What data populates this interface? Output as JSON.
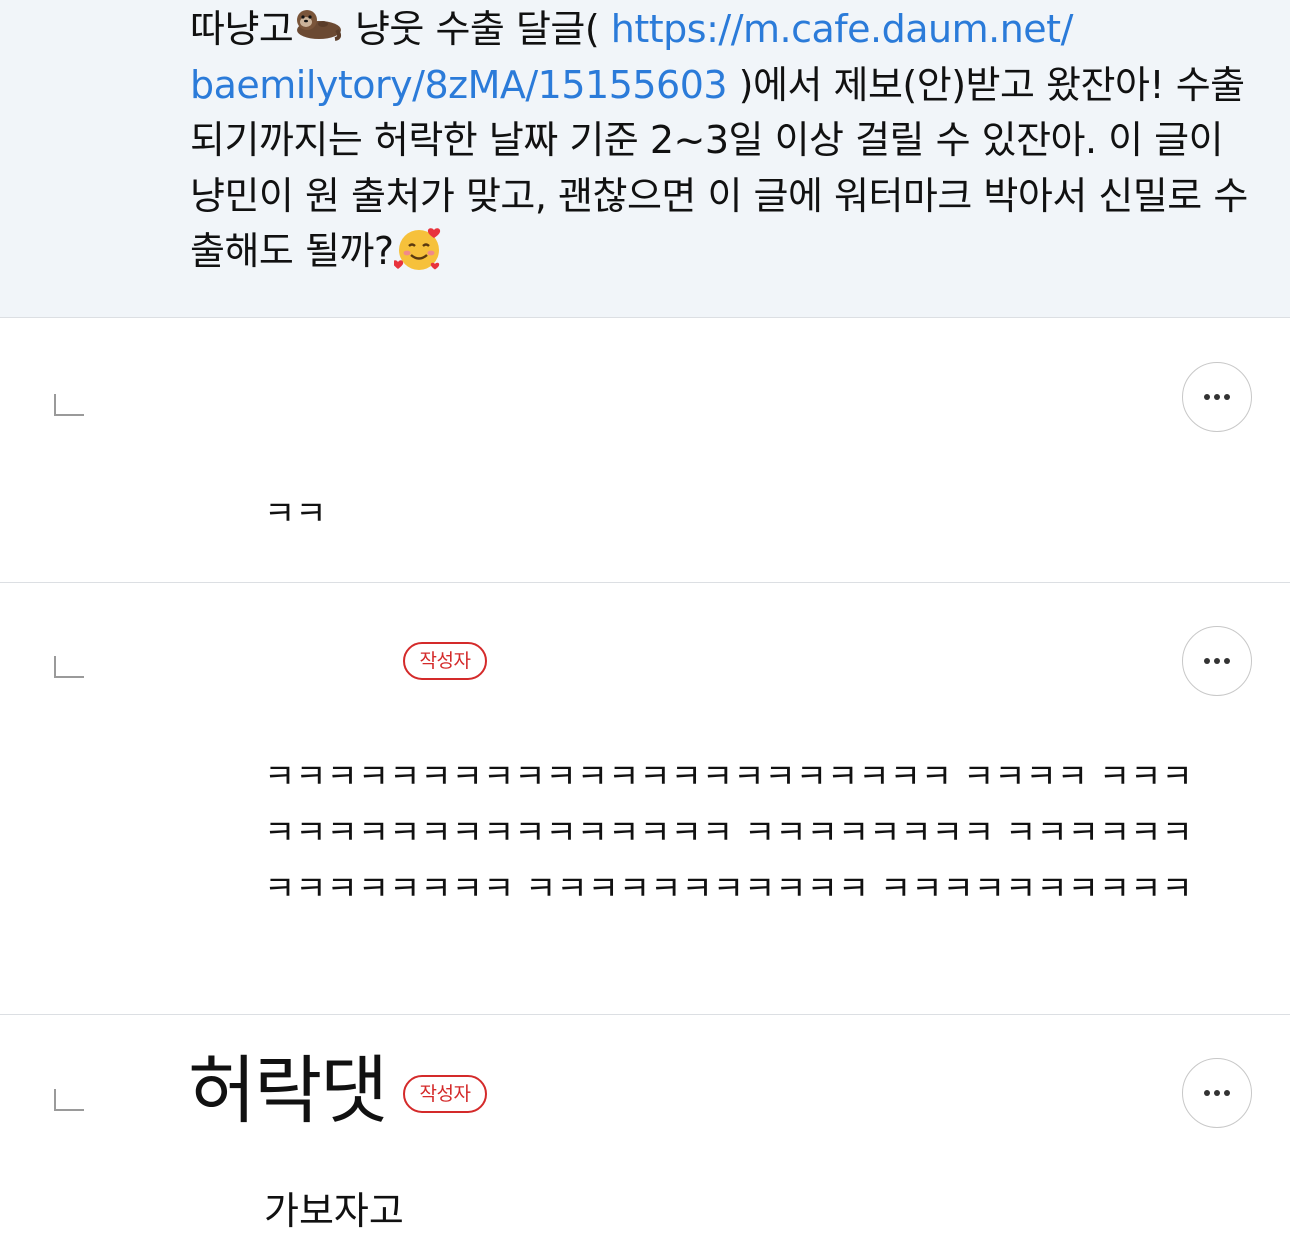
{
  "parent": {
    "t1": "따냥고",
    "t2": " 냥웃 수출 달글( ",
    "link": "https://m.cafe.daum.net/ baemilytory/8zMA/15155603",
    "t3": " )에서 제보(안)받고 왔잔아! 수출되기까지는 허락한 날짜 기준 2~3일 이상 걸릴 수 있잔아. 이 글이 냥민이 원 출처가 맞고, 괜찮으면 이 글에 워터마크 박아서 신밀로 수출해도 될까?",
    "icon_otter": "otter-emoji",
    "icon_smile": "smiling-face-with-hearts-emoji",
    "link_color": "#2b7bd9"
  },
  "replies": [
    {
      "body": "ㅋㅋ"
    },
    {
      "badge": "작성자",
      "body": "ㅋㅋㅋㅋㅋㅋㅋㅋㅋㅋㅋㅋㅋㅋㅋㅋㅋㅋㅋㅋㅋㅋ ㅋㅋㅋㅋ ㅋㅋㅋㅋㅋㅋㅋㅋㅋㅋㅋㅋㅋㅋㅋㅋㅋㅋ ㅋㅋㅋㅋㅋㅋㅋㅋ ㅋㅋㅋㅋㅋㅋㅋㅋㅋㅋㅋㅋㅋㅋ ㅋㅋㅋㅋㅋㅋㅋㅋㅋㅋㅋ ㅋㅋㅋㅋㅋㅋㅋㅋㅋㅋ"
    },
    {
      "name": "허락댓",
      "badge": "작성자",
      "body": "가보자고"
    }
  ],
  "colors": {
    "badge": "#d42a2a",
    "parent_bg": "#f1f5f9"
  }
}
